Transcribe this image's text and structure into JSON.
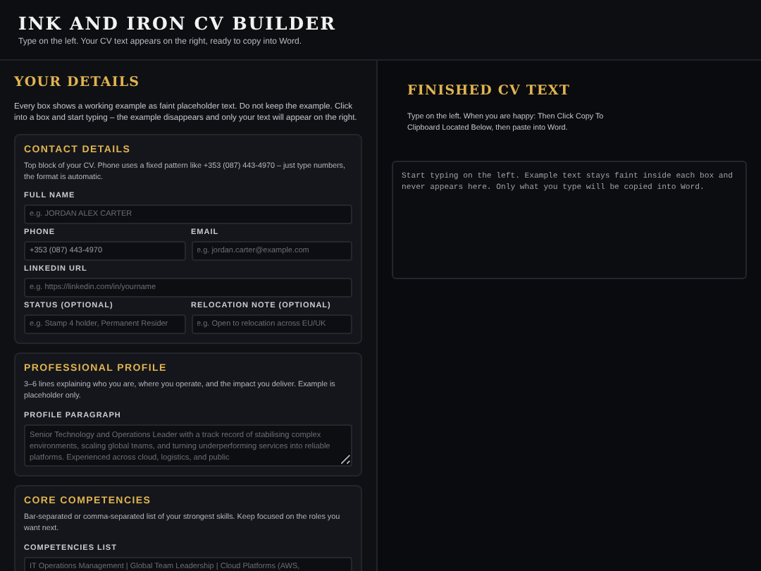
{
  "header": {
    "title": "INK AND IRON CV BUILDER",
    "subtitle": "Type on the left. Your CV text appears on the right, ready to copy into Word."
  },
  "details": {
    "title": "YOUR DETAILS",
    "intro": "Every box shows a working example as faint placeholder text. Do not keep the example. Click into a box and start typing – the example disappears and only your text will appear on the right.",
    "sections": [
      {
        "title": "CONTACT DETAILS",
        "hint": "Top block of your CV. Phone uses a fixed pattern like +353 (087) 443-4970 – just type numbers, the format is automatic.",
        "rows": [
          [
            {
              "label": "FULL NAME",
              "kind": "input",
              "placeholder": "e.g. JORDAN ALEX CARTER"
            }
          ],
          [
            {
              "label": "PHONE",
              "kind": "input",
              "value": "+353 (087) 443-4970"
            },
            {
              "label": "EMAIL",
              "kind": "input",
              "placeholder": "e.g. jordan.carter@example.com"
            }
          ],
          [
            {
              "label": "LINKEDIN URL",
              "kind": "input",
              "placeholder": "e.g. https://linkedin.com/in/yourname"
            }
          ],
          [
            {
              "label": "STATUS (OPTIONAL)",
              "kind": "input",
              "placeholder": "e.g. Stamp 4 holder, Permanent Resider"
            },
            {
              "label": "RELOCATION NOTE (OPTIONAL)",
              "kind": "input",
              "placeholder": "e.g. Open to relocation across EU/UK"
            }
          ]
        ]
      },
      {
        "title": "PROFESSIONAL PROFILE",
        "hint": "3–6 lines explaining who you are, where you operate, and the impact you deliver. Example is placeholder only.",
        "rows": [
          [
            {
              "label": "PROFILE PARAGRAPH",
              "kind": "textarea",
              "placeholder": "Senior Technology and Operations Leader with a track record of stabilising complex environments, scaling global teams, and turning underperforming services into reliable platforms. Experienced across cloud, logistics, and public"
            }
          ]
        ]
      },
      {
        "title": "CORE COMPETENCIES",
        "hint": "Bar-separated or comma-separated list of your strongest skills. Keep focused on the roles you want next.",
        "rows": [
          [
            {
              "label": "COMPETENCIES LIST",
              "kind": "input",
              "placeholder": "IT Operations Management | Global Team Leadership | Cloud Platforms (AWS,"
            }
          ]
        ]
      }
    ]
  },
  "output": {
    "title": "FINISHED CV TEXT",
    "intro": "Type on the left. When you are happy: Then Click Copy To Clipboard Located Below, then paste into Word.",
    "text": "Start typing on the left. Example text stays faint inside each box and never appears here. Only what you type will be copied into Word."
  }
}
